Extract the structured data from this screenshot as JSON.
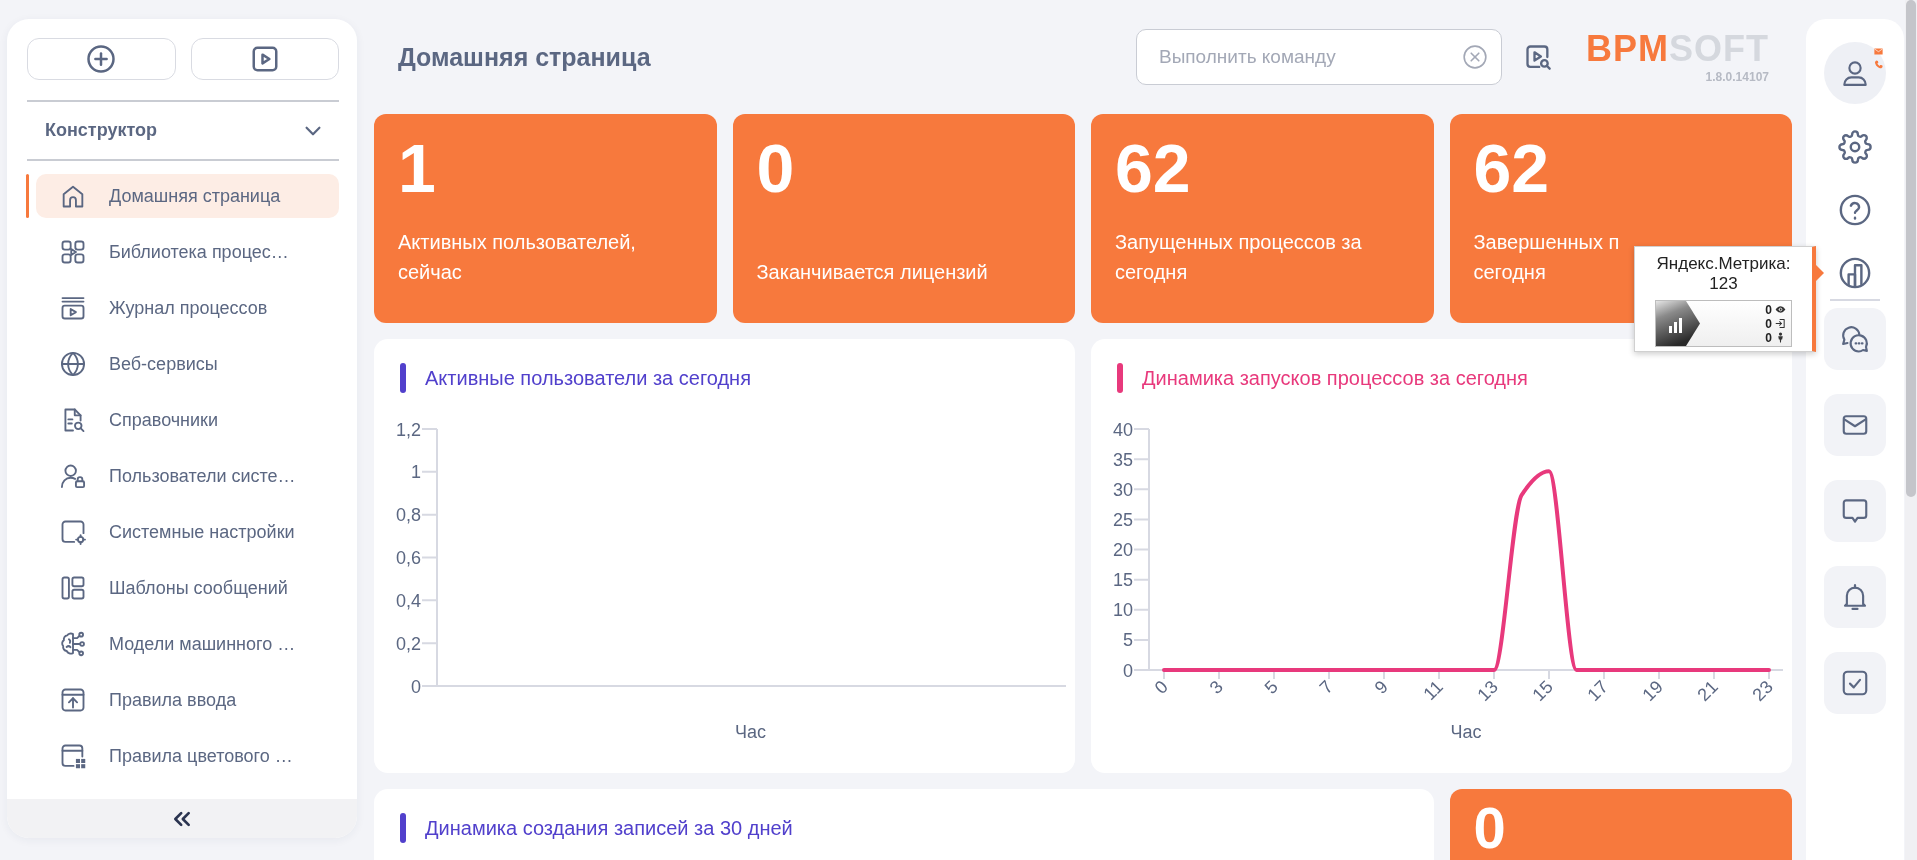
{
  "sidebar": {
    "section": {
      "title": "Конструктор",
      "expanded": true
    },
    "items": [
      {
        "label": "Домашняя страница",
        "selected": true
      },
      {
        "label": "Библиотека процес…",
        "selected": false
      },
      {
        "label": "Журнал процессов",
        "selected": false
      },
      {
        "label": "Веб-сервисы",
        "selected": false
      },
      {
        "label": "Справочники",
        "selected": false
      },
      {
        "label": "Пользователи систе…",
        "selected": false
      },
      {
        "label": "Системные настройки",
        "selected": false
      },
      {
        "label": "Шаблоны сообщений",
        "selected": false
      },
      {
        "label": "Модели машинного …",
        "selected": false
      },
      {
        "label": "Правила ввода",
        "selected": false
      },
      {
        "label": "Правила цветового …",
        "selected": false
      }
    ]
  },
  "header": {
    "title": "Домашняя страница",
    "command_field": {
      "placeholder": "Выполнить команду"
    },
    "logo": {
      "accent": "BPM",
      "rest": "SOFT"
    },
    "version": "1.8.0.14107"
  },
  "stat_cards": [
    {
      "value": "1",
      "label": "Активных пользователей, сейчас"
    },
    {
      "value": "0",
      "label": "Заканчивается лицензий"
    },
    {
      "value": "62",
      "label": "Запущенных процессов за сегодня"
    },
    {
      "value": "62",
      "label": "Завершенных п\nсегодня"
    }
  ],
  "charts": [
    {
      "title": "Активные пользователи за сегодня",
      "color": "#5140cc",
      "y_axis_labels": [
        "1,2",
        "1",
        "0,8",
        "0,6",
        "0,4",
        "0,2",
        "0"
      ],
      "x_axis_title": "Час"
    },
    {
      "title": "Динамика запусков процессов за сегодня",
      "color": "#e8397c",
      "chart_data": {
        "type": "line",
        "xlabel": "Час",
        "categories": [
          "0",
          null,
          "3",
          null,
          "5",
          null,
          "7",
          null,
          "9",
          null,
          "11",
          null,
          "13",
          null,
          "15",
          null,
          "17",
          null,
          "19",
          null,
          "21",
          null,
          "23"
        ],
        "ylim": [
          0,
          40
        ],
        "yticks": [
          0,
          5,
          10,
          15,
          20,
          25,
          30,
          35,
          40
        ],
        "series": [
          {
            "color": "#e8397c",
            "values": [
              0,
              0,
              0,
              0,
              0,
              0,
              0,
              0,
              0,
              0,
              0,
              0,
              0,
              29,
              33,
              0,
              0,
              0,
              0,
              0,
              0,
              0,
              0
            ]
          }
        ]
      }
    }
  ],
  "records_chart": {
    "title": "Динамика создания записей за 30 дней",
    "color": "#5140cc"
  },
  "bottom_stat": {
    "value": "0"
  },
  "tooltip": {
    "title": "Яндекс.Метрика:",
    "value": "123",
    "counter": [
      "0",
      "0",
      "0"
    ]
  }
}
